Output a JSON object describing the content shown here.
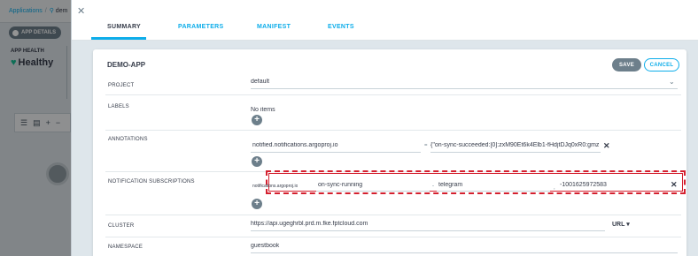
{
  "background": {
    "breadcrumb": {
      "root": "Applications",
      "current": "dem"
    },
    "app_details_label": "APP DETAILS",
    "app_health_label": "APP HEALTH",
    "health_status": "Healthy",
    "toolbar_add": "+",
    "toolbar_minus": "−"
  },
  "tabs": [
    {
      "label": "SUMMARY",
      "active": true
    },
    {
      "label": "PARAMETERS",
      "active": false
    },
    {
      "label": "MANIFEST",
      "active": false
    },
    {
      "label": "EVENTS",
      "active": false
    }
  ],
  "card": {
    "title": "DEMO-APP",
    "save_label": "SAVE",
    "cancel_label": "CANCEL"
  },
  "fields": {
    "project": {
      "label": "PROJECT",
      "value": "default"
    },
    "labels": {
      "label": "LABELS",
      "empty_text": "No items"
    },
    "annotations": {
      "label": "ANNOTATIONS",
      "key": "notified.notifications.argoproj.io",
      "value": "{\"on-sync-succeeded:[0]:zxM90Et6k4Elb1-fHdjtDJq0xR0:gmz"
    },
    "notification_subscriptions": {
      "label": "NOTIFICATION SUBSCRIPTIONS",
      "prefix": "notifications.argoproj.io",
      "trigger": "on-sync-running",
      "service": "telegram",
      "recipient": "-1001625972583"
    },
    "cluster": {
      "label": "CLUSTER",
      "value": "https://api.ugeghrbl.prd.m.fke.fptcloud.com",
      "mode": "URL"
    },
    "namespace": {
      "label": "NAMESPACE",
      "value": "guestbook"
    }
  },
  "glyphs": {
    "add": "+",
    "remove": "✕",
    "equals": "=",
    "dash": "-"
  },
  "colors": {
    "accent": "#0dadea",
    "healthy": "#18be94",
    "highlight": "#d4202f",
    "button": "#6d7f8b"
  }
}
